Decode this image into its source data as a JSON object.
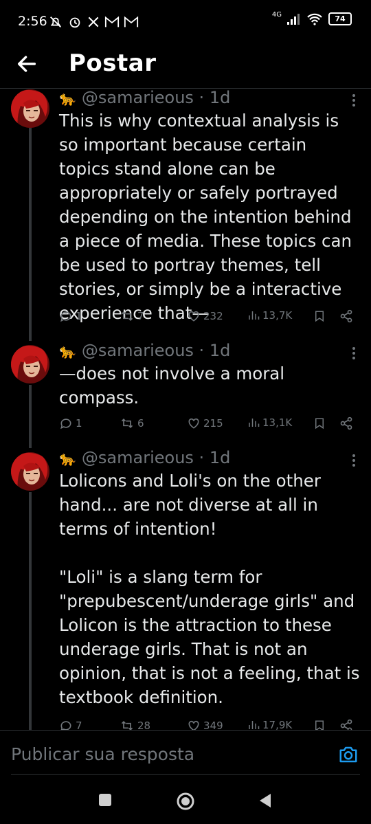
{
  "status_bar": {
    "time": "2:56",
    "network": "4G",
    "battery": "74"
  },
  "header": {
    "title": "Postar",
    "back_icon": "arrow-left-icon"
  },
  "tweets": [
    {
      "handle": "@samarieous",
      "separator": "·",
      "age": "1d",
      "text": "This is why contextual analysis is so important because certain topics stand alone can be appropriately or safely portrayed depending on the intention behind a piece of media. These topics can be used to portray themes, tell stories, or simply be a interactive experience that—",
      "replies": "1",
      "reposts": "7",
      "likes": "232",
      "views": "13,7K"
    },
    {
      "handle": "@samarieous",
      "separator": "·",
      "age": "1d",
      "text": "—does not involve a moral compass.",
      "replies": "1",
      "reposts": "6",
      "likes": "215",
      "views": "13,1K"
    },
    {
      "handle": "@samarieous",
      "separator": "·",
      "age": "1d",
      "text": "Lolicons and Loli's on the other hand... are not diverse at all in terms of intention!\n\n\"Loli\" is a slang term for \"prepubescent/underage girls\" and Lolicon is the attraction to these underage girls. That is not an opinion, that is not a feeling, that is textbook definition.",
      "replies": "7",
      "reposts": "28",
      "likes": "349",
      "views": "17,9K"
    }
  ],
  "reply_bar": {
    "placeholder": "Publicar sua resposta"
  },
  "colors": {
    "background": "#000000",
    "text": "#e7e9ea",
    "muted": "#71767b",
    "accent": "#1d9bf0"
  }
}
